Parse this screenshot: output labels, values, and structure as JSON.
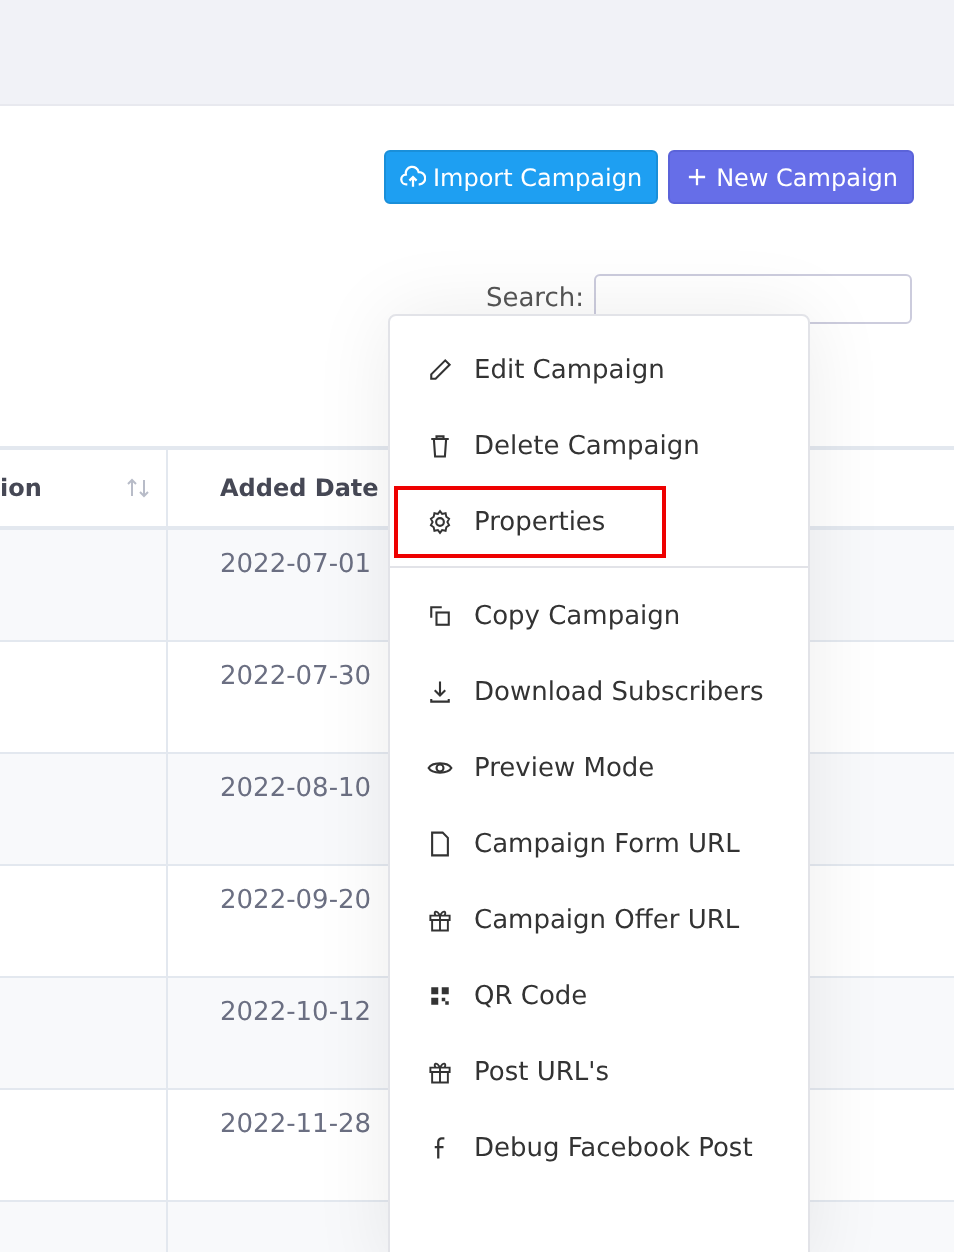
{
  "actions": [
    {
      "kind": "import",
      "label": "Import Campaign"
    },
    {
      "kind": "new",
      "label": "New Campaign"
    }
  ],
  "search": {
    "label": "Search:"
  },
  "table": {
    "columns": [
      {
        "label": "ion",
        "sortable": true
      },
      {
        "label": "Added Date",
        "sortable": false
      }
    ],
    "rows": [
      {
        "added_date": "2022-07-01"
      },
      {
        "added_date": "2022-07-30"
      },
      {
        "added_date": "2022-08-10"
      },
      {
        "added_date": "2022-09-20"
      },
      {
        "added_date": "2022-10-12"
      },
      {
        "added_date": "2022-11-28"
      }
    ]
  },
  "context_menu": {
    "items": [
      {
        "kind": "edit",
        "label": "Edit Campaign",
        "highlighted": false
      },
      {
        "kind": "delete",
        "label": "Delete Campaign",
        "highlighted": false
      },
      {
        "kind": "settings",
        "label": "Properties",
        "highlighted": true
      },
      {
        "kind": "divider"
      },
      {
        "kind": "copy",
        "label": "Copy Campaign",
        "highlighted": false
      },
      {
        "kind": "download",
        "label": "Download Subscribers",
        "highlighted": false
      },
      {
        "kind": "eye",
        "label": "Preview Mode",
        "highlighted": false
      },
      {
        "kind": "file",
        "label": "Campaign Form URL",
        "highlighted": false
      },
      {
        "kind": "gift",
        "label": "Campaign Offer URL",
        "highlighted": false
      },
      {
        "kind": "qr",
        "label": "QR Code",
        "highlighted": false
      },
      {
        "kind": "gift",
        "label": "Post URL's",
        "highlighted": false
      },
      {
        "kind": "facebook",
        "label": "Debug Facebook Post",
        "highlighted": false
      }
    ]
  }
}
